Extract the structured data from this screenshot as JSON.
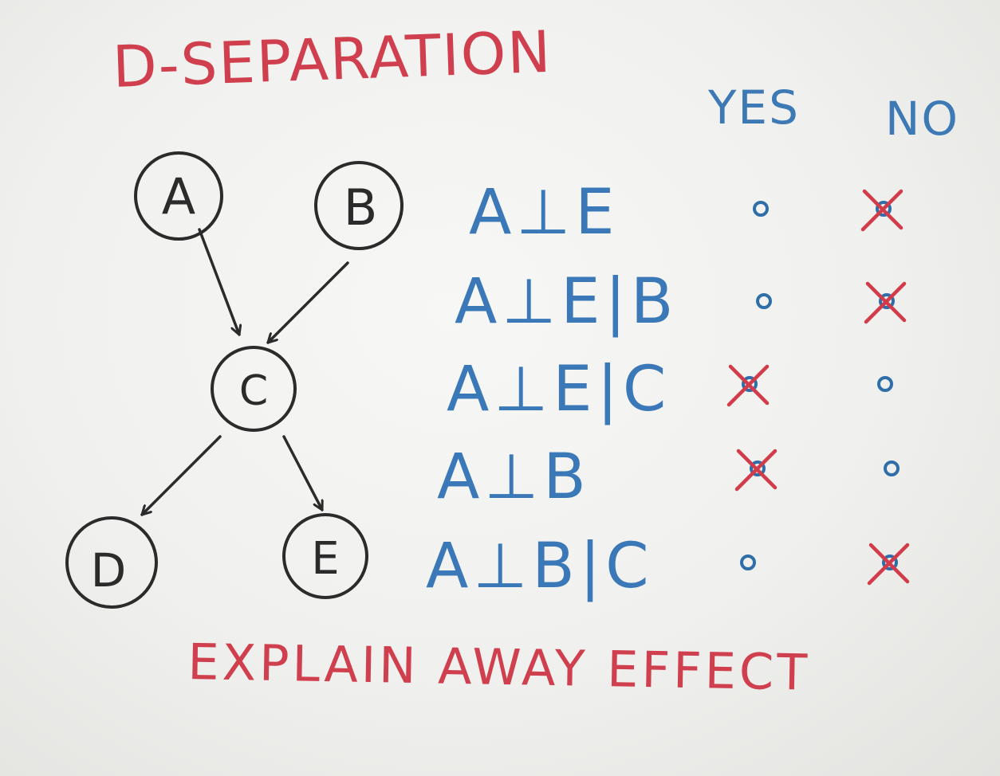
{
  "title": "D-SEPARATION",
  "footer": "EXPLAIN AWAY EFFECT",
  "columns": {
    "yes": "YES",
    "no": "NO"
  },
  "graph": {
    "nodes": [
      "A",
      "B",
      "C",
      "D",
      "E"
    ],
    "edges": [
      [
        "A",
        "C"
      ],
      [
        "B",
        "C"
      ],
      [
        "C",
        "D"
      ],
      [
        "C",
        "E"
      ]
    ]
  },
  "rows": [
    {
      "label": "A⊥E",
      "answer": "no"
    },
    {
      "label": "A⊥E|B",
      "answer": "no"
    },
    {
      "label": "A⊥E|C",
      "answer": "yes"
    },
    {
      "label": "A⊥B",
      "answer": "yes"
    },
    {
      "label": "A⊥B|C",
      "answer": "no"
    }
  ],
  "colors": {
    "title": "#cf3f4e",
    "statements": "#3b78b8",
    "checkmark": "#d23c4a",
    "graph": "#2b2b2b"
  }
}
